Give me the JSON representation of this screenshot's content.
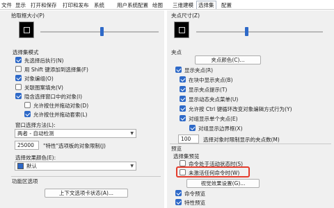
{
  "tabs": [
    {
      "label": "文件"
    },
    {
      "label": "显示"
    },
    {
      "label": "打开和保存"
    },
    {
      "label": "打印和发布"
    },
    {
      "label": "系统"
    },
    {
      "label": "用户系统配置"
    },
    {
      "label": "绘图"
    },
    {
      "label": "三维建模"
    },
    {
      "label": "选择集"
    },
    {
      "label": "配置"
    }
  ],
  "active_tab": "选择集",
  "left": {
    "pickbox_size_label": "拾取框大小(P)",
    "pickbox_slider_level": 0.52,
    "selection_modes": {
      "title": "选择集模式",
      "items": [
        {
          "label": "先选择后执行(N)",
          "checked": true
        },
        {
          "label": "用 Shift 键添加到选择集(F)",
          "checked": false
        },
        {
          "label": "对象编组(O)",
          "checked": true
        },
        {
          "label": "关联图案填充(V)",
          "checked": false
        },
        {
          "label": "隐含选择窗口中的对象(I)",
          "checked": true
        },
        {
          "label": "允许按住并拖动对象(D)",
          "checked": false
        },
        {
          "label": "允许按住并拖动套索(L)",
          "checked": true
        }
      ]
    },
    "window_method": {
      "label": "窗口选择方法(L):",
      "value": "两者 - 自动检测"
    },
    "feature_limit": {
      "value": "25000",
      "label": "\"特性\"选项板的对象限制(J)"
    },
    "effect_color": {
      "label": "选择效果颜色(E):",
      "value": "默认",
      "color": "#2e69c8"
    },
    "ribbon": {
      "title": "功能区选项",
      "button": "上下文选项卡状态(A)..."
    }
  },
  "right": {
    "grip_size_label": "夹点尺寸(Z)",
    "grip_slider_level": 0.4,
    "grips_title": "夹点",
    "grip_color_button": "夹点颜色(C)...",
    "grip_items": [
      {
        "label": "显示夹点(R)",
        "checked": true
      },
      {
        "label": "在块中显示夹点(B)",
        "checked": true
      },
      {
        "label": "显示夹点提示(T)",
        "checked": true
      },
      {
        "label": "显示动态夹点菜单(U)",
        "checked": true
      },
      {
        "label": "允许按 Ctrl 键循环改变对象编辑方式行为(Y)",
        "checked": true
      },
      {
        "label": "对组显示单个夹点(E)",
        "checked": true
      },
      {
        "label": "对组显示边界框(X)",
        "checked": true
      }
    ],
    "grip_limit": {
      "value": "100",
      "label": "选择对象时限制显示的夹点数(M)"
    },
    "preview": {
      "title": "预览",
      "subtitle": "选择集预览",
      "items": [
        {
          "label": "命令处于活动状态时(S)",
          "checked": false
        },
        {
          "label": "未激活任何命令时(W)",
          "checked": false
        }
      ],
      "visual_button": "视觉效果设置(G)...",
      "cmd_preview": {
        "label": "命令预览",
        "checked": true
      },
      "prop_preview": {
        "label": "特性预览",
        "checked": true
      }
    }
  },
  "colors": {
    "accent": "#2e69c8",
    "highlight": "#e43b2b"
  }
}
